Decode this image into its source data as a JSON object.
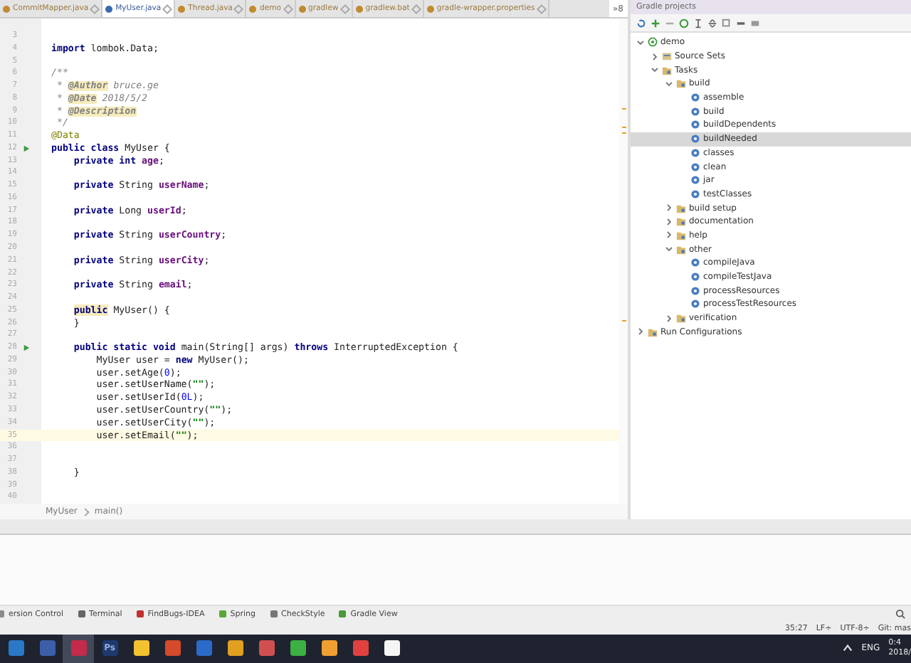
{
  "editor_tabs": [
    {
      "label": "CommitMapper.java",
      "selected": false
    },
    {
      "label": "MyUser.java",
      "selected": true
    },
    {
      "label": "Thread.java",
      "selected": false
    },
    {
      "label": "demo",
      "selected": false
    },
    {
      "label": "gradlew",
      "selected": false
    },
    {
      "label": "gradlew.bat",
      "selected": false
    },
    {
      "label": "gradle-wrapper.properties",
      "selected": false
    }
  ],
  "tabs_overflow": "»8",
  "code_lines": [
    {
      "number": "3",
      "current": false,
      "runnable": false
    },
    {
      "number": "4",
      "current": false,
      "runnable": false,
      "tokens": [
        {
          "text": "import ",
          "kind": "keyword"
        },
        {
          "text": "lombok.Data;",
          "kind": "plain"
        }
      ]
    },
    {
      "number": "5",
      "current": false,
      "runnable": false
    },
    {
      "number": "6",
      "current": false,
      "runnable": false,
      "tokens": [
        {
          "text": "/**",
          "kind": "comment"
        }
      ]
    },
    {
      "number": "7",
      "current": false,
      "runnable": false,
      "tokens": [
        {
          "text": " * ",
          "kind": "comment"
        },
        {
          "text": "@Author",
          "kind": "doctag"
        },
        {
          "text": " bruce.ge",
          "kind": "comment"
        }
      ]
    },
    {
      "number": "8",
      "current": false,
      "runnable": false,
      "tokens": [
        {
          "text": " * ",
          "kind": "comment"
        },
        {
          "text": "@Date",
          "kind": "doctag"
        },
        {
          "text": " 2018/5/2",
          "kind": "comment"
        }
      ]
    },
    {
      "number": "9",
      "current": false,
      "runnable": false,
      "tokens": [
        {
          "text": " * ",
          "kind": "comment"
        },
        {
          "text": "@Description",
          "kind": "doctag"
        }
      ]
    },
    {
      "number": "10",
      "current": false,
      "runnable": false,
      "tokens": [
        {
          "text": " */",
          "kind": "comment"
        }
      ]
    },
    {
      "number": "11",
      "current": false,
      "runnable": false,
      "tokens": [
        {
          "text": "@Data",
          "kind": "annotation"
        }
      ]
    },
    {
      "number": "12",
      "current": false,
      "runnable": true,
      "tokens": [
        {
          "text": "public class ",
          "kind": "keyword"
        },
        {
          "text": "MyUser {",
          "kind": "plain"
        }
      ]
    },
    {
      "number": "13",
      "current": false,
      "runnable": false,
      "tokens": [
        {
          "text": "    private int ",
          "kind": "keyword"
        },
        {
          "text": "age",
          "kind": "field"
        },
        {
          "text": ";",
          "kind": "plain"
        }
      ]
    },
    {
      "number": "14",
      "current": false,
      "runnable": false
    },
    {
      "number": "15",
      "current": false,
      "runnable": false,
      "tokens": [
        {
          "text": "    private ",
          "kind": "keyword"
        },
        {
          "text": "String ",
          "kind": "plain"
        },
        {
          "text": "userName",
          "kind": "field"
        },
        {
          "text": ";",
          "kind": "plain"
        }
      ]
    },
    {
      "number": "16",
      "current": false,
      "runnable": false
    },
    {
      "number": "17",
      "current": false,
      "runnable": false,
      "tokens": [
        {
          "text": "    private ",
          "kind": "keyword"
        },
        {
          "text": "Long ",
          "kind": "plain"
        },
        {
          "text": "userId",
          "kind": "field"
        },
        {
          "text": ";",
          "kind": "plain"
        }
      ]
    },
    {
      "number": "18",
      "current": false,
      "runnable": false
    },
    {
      "number": "19",
      "current": false,
      "runnable": false,
      "tokens": [
        {
          "text": "    private ",
          "kind": "keyword"
        },
        {
          "text": "String ",
          "kind": "plain"
        },
        {
          "text": "userCountry",
          "kind": "field"
        },
        {
          "text": ";",
          "kind": "plain"
        }
      ]
    },
    {
      "number": "20",
      "current": false,
      "runnable": false
    },
    {
      "number": "21",
      "current": false,
      "runnable": false,
      "tokens": [
        {
          "text": "    private ",
          "kind": "keyword"
        },
        {
          "text": "String ",
          "kind": "plain"
        },
        {
          "text": "userCity",
          "kind": "field"
        },
        {
          "text": ";",
          "kind": "plain"
        }
      ]
    },
    {
      "number": "22",
      "current": false,
      "runnable": false
    },
    {
      "number": "23",
      "current": false,
      "runnable": false,
      "tokens": [
        {
          "text": "    private ",
          "kind": "keyword"
        },
        {
          "text": "String ",
          "kind": "plain"
        },
        {
          "text": "email",
          "kind": "field"
        },
        {
          "text": ";",
          "kind": "plain"
        }
      ]
    },
    {
      "number": "24",
      "current": false,
      "runnable": false
    },
    {
      "number": "25",
      "current": false,
      "runnable": false,
      "tokens": [
        {
          "text": "    public",
          "kind": "keyword-highlighted"
        },
        {
          "text": " MyUser() {",
          "kind": "plain"
        }
      ]
    },
    {
      "number": "26",
      "current": false,
      "runnable": false,
      "tokens": [
        {
          "text": "    }",
          "kind": "plain"
        }
      ]
    },
    {
      "number": "27",
      "current": false,
      "runnable": false
    },
    {
      "number": "28",
      "current": false,
      "runnable": true,
      "tokens": [
        {
          "text": "    public static void ",
          "kind": "keyword"
        },
        {
          "text": "main(String[] args) ",
          "kind": "plain"
        },
        {
          "text": "throws ",
          "kind": "keyword"
        },
        {
          "text": "InterruptedException {",
          "kind": "plain"
        }
      ]
    },
    {
      "number": "29",
      "current": false,
      "runnable": false,
      "tokens": [
        {
          "text": "        MyUser user = ",
          "kind": "plain"
        },
        {
          "text": "new ",
          "kind": "keyword"
        },
        {
          "text": "MyUser();",
          "kind": "plain"
        }
      ]
    },
    {
      "number": "30",
      "current": false,
      "runnable": false,
      "tokens": [
        {
          "text": "        user.setAge(",
          "kind": "plain"
        },
        {
          "text": "0",
          "kind": "number"
        },
        {
          "text": ");",
          "kind": "plain"
        }
      ]
    },
    {
      "number": "31",
      "current": false,
      "runnable": false,
      "tokens": [
        {
          "text": "        user.setUserName(",
          "kind": "plain"
        },
        {
          "text": "\"\"",
          "kind": "string"
        },
        {
          "text": ");",
          "kind": "plain"
        }
      ]
    },
    {
      "number": "32",
      "current": false,
      "runnable": false,
      "tokens": [
        {
          "text": "        user.setUserId(",
          "kind": "plain"
        },
        {
          "text": "0L",
          "kind": "number"
        },
        {
          "text": ");",
          "kind": "plain"
        }
      ]
    },
    {
      "number": "33",
      "current": false,
      "runnable": false,
      "tokens": [
        {
          "text": "        user.setUserCountry(",
          "kind": "plain"
        },
        {
          "text": "\"\"",
          "kind": "string"
        },
        {
          "text": ");",
          "kind": "plain"
        }
      ]
    },
    {
      "number": "34",
      "current": false,
      "runnable": false,
      "tokens": [
        {
          "text": "        user.setUserCity(",
          "kind": "plain"
        },
        {
          "text": "\"\"",
          "kind": "string"
        },
        {
          "text": ");",
          "kind": "plain"
        }
      ]
    },
    {
      "number": "35",
      "current": true,
      "runnable": false,
      "tokens": [
        {
          "text": "        user.setEmail(",
          "kind": "plain"
        },
        {
          "text": "\"\"",
          "kind": "string"
        },
        {
          "text": ");",
          "kind": "plain"
        }
      ]
    },
    {
      "number": "36",
      "current": false,
      "runnable": false
    },
    {
      "number": "37",
      "current": false,
      "runnable": false
    },
    {
      "number": "38",
      "current": false,
      "runnable": false,
      "tokens": [
        {
          "text": "    }",
          "kind": "plain"
        }
      ]
    },
    {
      "number": "39",
      "current": false,
      "runnable": false
    },
    {
      "number": "40",
      "current": false,
      "runnable": false
    }
  ],
  "breadcrumbs": [
    "MyUser",
    "main()"
  ],
  "gradle_panel": {
    "title": "Gradle projects",
    "tree": [
      {
        "label": "demo",
        "kind": "project",
        "expanded": true,
        "selected": false,
        "children": [
          {
            "label": "Source Sets",
            "kind": "sourceset",
            "expanded": false,
            "selected": false
          },
          {
            "label": "Tasks",
            "kind": "folder",
            "expanded": true,
            "selected": false,
            "children": [
              {
                "label": "build",
                "kind": "folder",
                "expanded": true,
                "selected": false,
                "children": [
                  {
                    "label": "assemble",
                    "kind": "task",
                    "selected": false
                  },
                  {
                    "label": "build",
                    "kind": "task",
                    "selected": false
                  },
                  {
                    "label": "buildDependents",
                    "kind": "task",
                    "selected": false
                  },
                  {
                    "label": "buildNeeded",
                    "kind": "task",
                    "selected": true
                  },
                  {
                    "label": "classes",
                    "kind": "task",
                    "selected": false
                  },
                  {
                    "label": "clean",
                    "kind": "task",
                    "selected": false
                  },
                  {
                    "label": "jar",
                    "kind": "task",
                    "selected": false
                  },
                  {
                    "label": "testClasses",
                    "kind": "task",
                    "selected": false
                  }
                ]
              },
              {
                "label": "build setup",
                "kind": "folder",
                "expanded": false,
                "selected": false
              },
              {
                "label": "documentation",
                "kind": "folder",
                "expanded": false,
                "selected": false
              },
              {
                "label": "help",
                "kind": "folder",
                "expanded": false,
                "selected": false
              },
              {
                "label": "other",
                "kind": "folder",
                "expanded": true,
                "selected": false,
                "children": [
                  {
                    "label": "compileJava",
                    "kind": "task",
                    "selected": false
                  },
                  {
                    "label": "compileTestJava",
                    "kind": "task",
                    "selected": false
                  },
                  {
                    "label": "processResources",
                    "kind": "task",
                    "selected": false
                  },
                  {
                    "label": "processTestResources",
                    "kind": "task",
                    "selected": false
                  }
                ]
              },
              {
                "label": "verification",
                "kind": "folder",
                "expanded": false,
                "selected": false
              }
            ]
          }
        ]
      },
      {
        "label": "Run Configurations",
        "kind": "folder",
        "expanded": false,
        "selected": false
      }
    ]
  },
  "tool_windows": [
    {
      "label": "ersion Control",
      "kind": "vcs"
    },
    {
      "label": "Terminal",
      "kind": "terminal"
    },
    {
      "label": "FindBugs-IDEA",
      "kind": "bug"
    },
    {
      "label": "Spring",
      "kind": "leaf"
    },
    {
      "label": "CheckStyle",
      "kind": "check"
    },
    {
      "label": "Gradle View",
      "kind": "plus"
    }
  ],
  "status_bar": {
    "position": "35:27",
    "line_separator": "LF÷",
    "encoding": "UTF-8÷",
    "vcs": "Git: mas"
  },
  "taskbar": {
    "apps": [
      {
        "color": "#2a78c8",
        "selected": false
      },
      {
        "color": "#3b5fa8",
        "selected": false
      },
      {
        "color": "#c42a4a",
        "selected": true
      },
      {
        "color": "#1d3a6e",
        "selected": false,
        "label": "Ps"
      },
      {
        "color": "#f2c230",
        "selected": false
      },
      {
        "color": "#d44a2a",
        "selected": false
      },
      {
        "color": "#2a6ac8",
        "selected": false
      },
      {
        "color": "#e0a020",
        "selected": false
      },
      {
        "color": "#d05050",
        "selected": false
      },
      {
        "color": "#3cb043",
        "selected": false
      },
      {
        "color": "#f0a030",
        "selected": false
      },
      {
        "color": "#e04040",
        "selected": false
      },
      {
        "color": "#f5f5f5",
        "selected": false
      }
    ],
    "language": "ENG",
    "time": "0:4",
    "date": "2018/"
  }
}
